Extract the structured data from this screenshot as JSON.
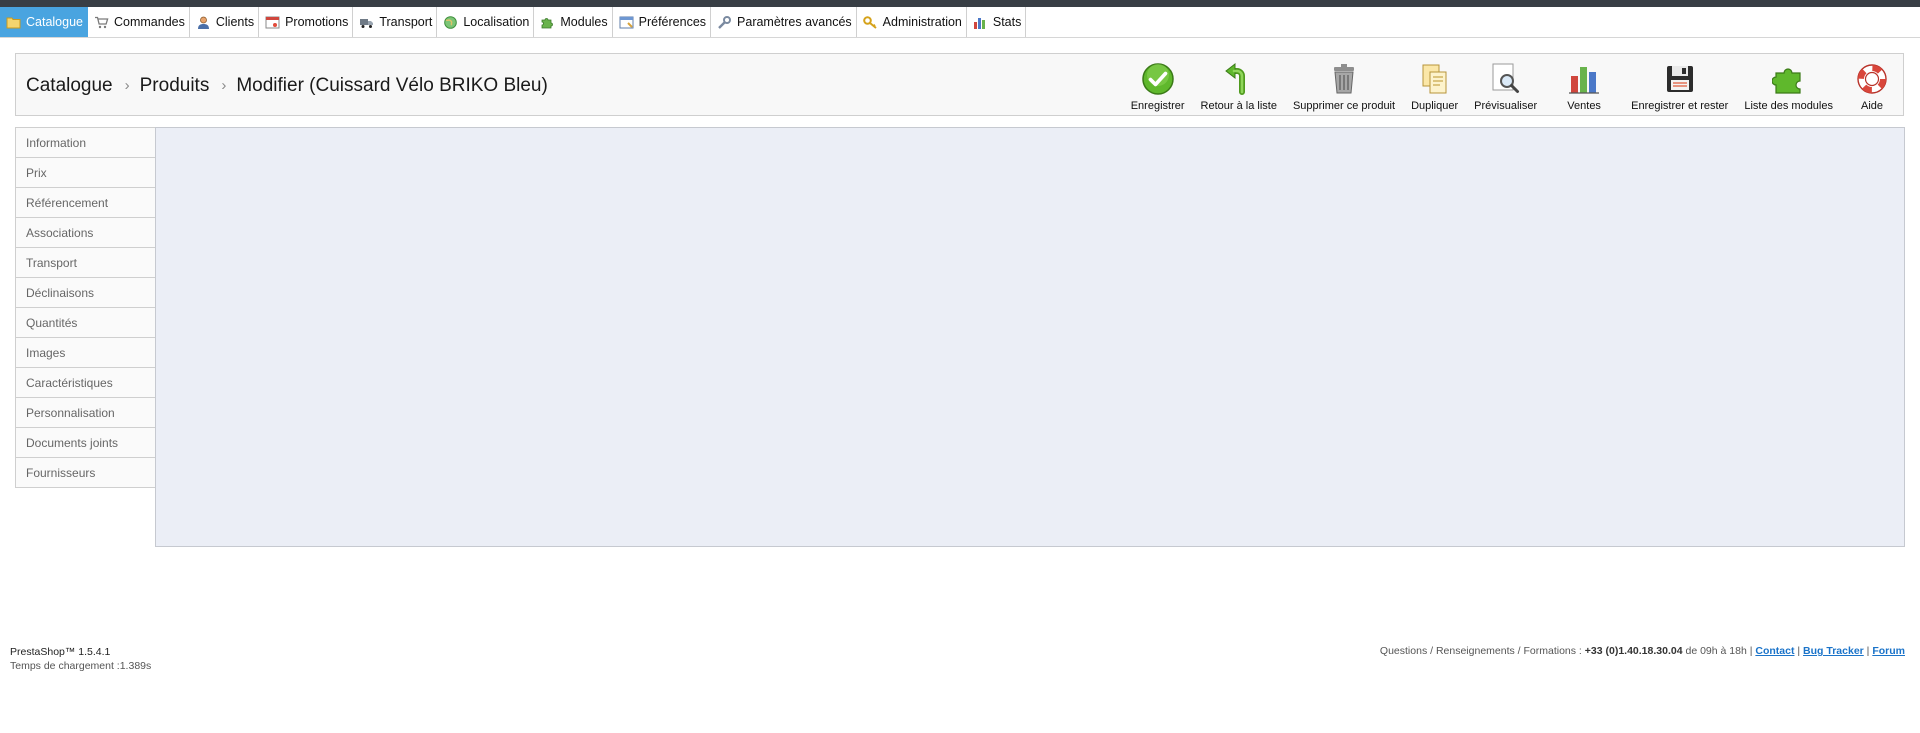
{
  "menu": [
    {
      "label": "Catalogue",
      "icon": "folder-icon",
      "active": true
    },
    {
      "label": "Commandes",
      "icon": "cart-icon"
    },
    {
      "label": "Clients",
      "icon": "user-icon"
    },
    {
      "label": "Promotions",
      "icon": "tag-icon"
    },
    {
      "label": "Transport",
      "icon": "truck-icon"
    },
    {
      "label": "Localisation",
      "icon": "globe-icon"
    },
    {
      "label": "Modules",
      "icon": "puzzle-icon"
    },
    {
      "label": "Préférences",
      "icon": "window-icon"
    },
    {
      "label": "Paramètres avancés",
      "icon": "wrench-icon"
    },
    {
      "label": "Administration",
      "icon": "key-icon"
    },
    {
      "label": "Stats",
      "icon": "chart-icon"
    }
  ],
  "breadcrumb": {
    "level1": "Catalogue",
    "level2": "Produits",
    "level3": "Modifier (Cuissard Vélo BRIKO Bleu)",
    "separator": "›"
  },
  "toolbar": {
    "save": "Enregistrer",
    "back": "Retour à la liste",
    "delete": "Supprimer ce produit",
    "duplicate": "Dupliquer",
    "preview": "Prévisualiser",
    "sales": "Ventes",
    "save_stay": "Enregistrer et rester",
    "modules": "Liste des modules",
    "help": "Aide"
  },
  "tabs": [
    "Information",
    "Prix",
    "Référencement",
    "Associations",
    "Transport",
    "Déclinaisons",
    "Quantités",
    "Images",
    "Caractéristiques",
    "Personnalisation",
    "Documents joints",
    "Fournisseurs"
  ],
  "footer": {
    "version": "PrestaShop™ 1.5.4.1",
    "load_time": "Temps de chargement :1.389s",
    "info_prefix": "Questions / Renseignements / Formations : ",
    "phone": "+33 (0)1.40.18.30.04",
    "hours": " de 09h à 18h ",
    "contact": "Contact",
    "bug_tracker": "Bug Tracker",
    "forum": "Forum"
  },
  "colors": {
    "accent": "#49a4e0",
    "content_bg": "#ebeef6",
    "link": "#1a73c9"
  }
}
